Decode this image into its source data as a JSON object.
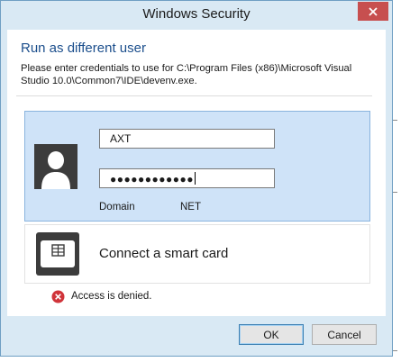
{
  "window": {
    "title": "Windows Security"
  },
  "prompt": {
    "heading": "Run as different user",
    "description": "Please enter credentials to use for C:\\Program Files (x86)\\Microsoft Visual Studio 10.0\\Common7\\IDE\\devenv.exe."
  },
  "credential": {
    "username_value": "AXT",
    "password_value": "●●●●●●●●●●●●",
    "domain_label": "Domain",
    "domain_value": "NET"
  },
  "smart_card": {
    "label": "Connect a smart card"
  },
  "error": {
    "message": "Access is denied."
  },
  "buttons": {
    "ok_label": "OK",
    "cancel_label": "Cancel"
  },
  "icons": {
    "close": "close-icon",
    "user": "user-avatar-icon",
    "smart_card": "smart-card-icon",
    "error": "error-icon"
  },
  "colors": {
    "frame": "#d9e9f4",
    "close_button": "#c74f4f",
    "heading": "#1b4e8c",
    "selected_tile": "#cfe3f8",
    "error": "#d0343a"
  }
}
